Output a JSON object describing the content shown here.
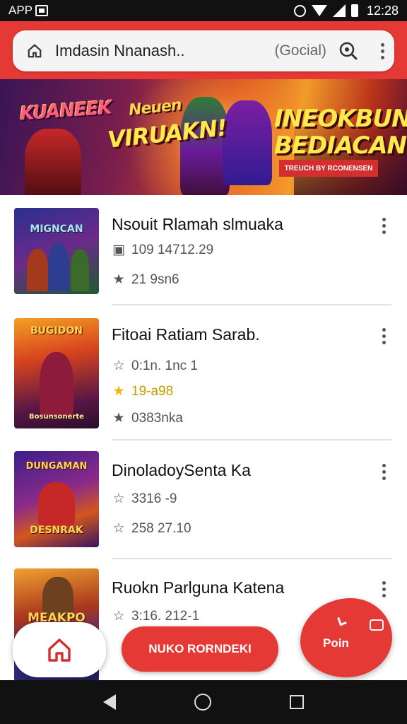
{
  "status_bar": {
    "app_label": "APP",
    "time": "12:28"
  },
  "header": {
    "search_text": "Imdasin Nnanash..",
    "search_scope": "(Gocial)",
    "icons": [
      "home-icon",
      "lens-icon",
      "more-vert-icon"
    ]
  },
  "banner": {
    "left_title": "KUANEEK",
    "mid_title_top": "Neuen",
    "mid_title": "VIRUAKN!",
    "right_title_1": "INEOKBUN",
    "right_title_2": "BEDIACAN",
    "tag": "TREUCH BY RCONENSEN"
  },
  "games": [
    {
      "title": "Nsouit Rlamah slmuaka",
      "thumb_text": "MIGNCAN",
      "meta": [
        {
          "icon": "download-icon",
          "text": "109 14712.29"
        },
        {
          "icon": "star-icon",
          "text": "21 9sn6"
        }
      ]
    },
    {
      "title": "Fitoai Ratiam Sarab.",
      "thumb_text": "BUGIDON",
      "thumb_sub": "Bosunsonerte",
      "meta": [
        {
          "icon": "star-outline-icon",
          "text": "0:1n. 1nc 1"
        },
        {
          "icon": "star-gold-icon",
          "text": "19-a98"
        },
        {
          "icon": "star-icon",
          "text": "0383nka"
        }
      ]
    },
    {
      "title": "DinoladoySenta Ka",
      "thumb_text": "DUNGAMAN",
      "thumb_sub": "DESNRAK",
      "meta": [
        {
          "icon": "star-outline-icon",
          "text": "3316 -9"
        },
        {
          "icon": "star-outline-icon",
          "text": "258 27.10"
        }
      ]
    },
    {
      "title": "Ruokn Parlguna Katena",
      "thumb_text": "MEAKPO",
      "meta": [
        {
          "icon": "star-outline-icon",
          "text": "3:16. 212-1"
        }
      ]
    }
  ],
  "actions": {
    "main_label": "NUKO RORNDEKI",
    "blob_label": "Poin"
  },
  "colors": {
    "accent": "#e53935",
    "gold": "#f2b600",
    "status_bar": "#111111"
  }
}
